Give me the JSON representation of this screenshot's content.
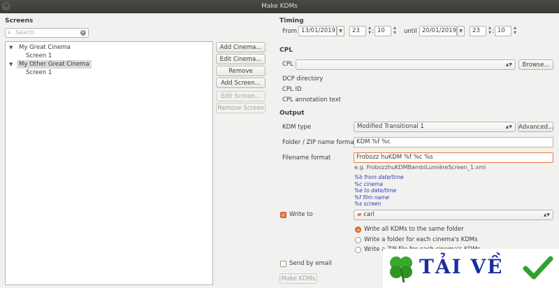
{
  "window": {
    "title": "Make KDMs"
  },
  "screens": {
    "heading": "Screens",
    "search_placeholder": "Search",
    "tree": [
      {
        "label": "My Great Cinema",
        "children": [
          "Screen 1"
        ]
      },
      {
        "label": "My Other Great Cinema",
        "children": [
          "Screen 1"
        ]
      }
    ],
    "buttons": {
      "add_cinema": "Add Cinema...",
      "edit_cinema": "Edit Cinema...",
      "remove_cinema": "Remove Cinema",
      "add_screen": "Add Screen...",
      "edit_screen": "Edit Screen...",
      "remove_screen": "Remove Screen"
    }
  },
  "timing": {
    "heading": "Timing",
    "from_label": "From",
    "from_date": "13/01/2019",
    "from_hour": "23",
    "from_minute": "10",
    "until_label": "until",
    "until_date": "20/01/2019",
    "until_hour": "23",
    "until_minute": "10"
  },
  "cpl": {
    "heading": "CPL",
    "cpl_label": "CPL",
    "browse": "Browse...",
    "dcp_directory": "DCP directory",
    "cpl_id": "CPL ID",
    "annotation": "CPL annotation text"
  },
  "output": {
    "heading": "Output",
    "kdm_type_label": "KDM type",
    "kdm_type_value": "Modified Transitional 1",
    "advanced": "Advanced...",
    "folder_label": "Folder / ZIP name format",
    "folder_value": "KDM %f %c",
    "filename_label": "Filename format",
    "filename_value": "Frobozz huKDM %f %c %s",
    "example": "e.g. FrobozzhuKDMBambiLumièreScreen_1.xml",
    "hints": [
      "%b from date/time",
      "%c cinema",
      "%e to date/time",
      "%f film name",
      "%s screen"
    ],
    "write_to_label": "Write to",
    "write_to_value": "carl",
    "radio_same": "Write all KDMs to the same folder",
    "radio_folder": "Write a folder for each cinema's KDMs",
    "radio_zip": "Write a ZIP file for each cinema's KDMs",
    "send_email": "Send by email",
    "make_kdms": "Make KDMs"
  },
  "watermark": {
    "text": "TẢI VỀ"
  },
  "colors": {
    "accent": "#e9773e",
    "hint": "#2e3eb5",
    "titlebar": "#3b3a36"
  }
}
